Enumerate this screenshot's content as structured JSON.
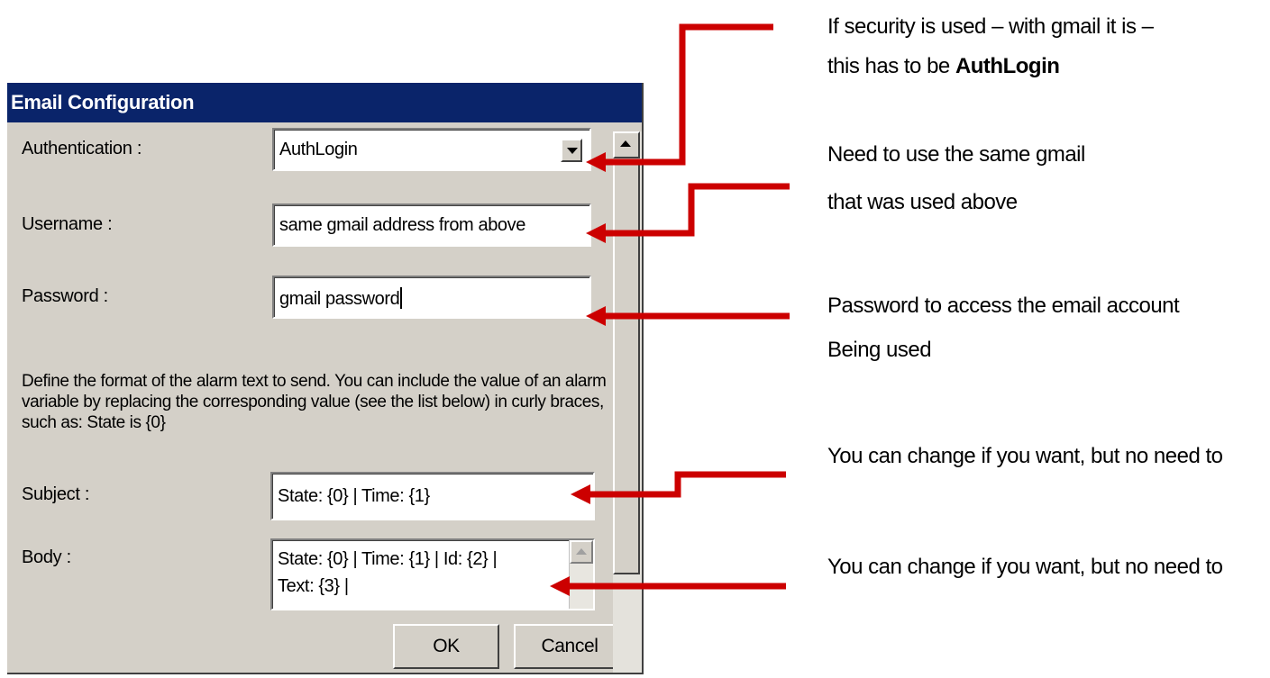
{
  "dialog": {
    "title": "Email Configuration",
    "fields": {
      "authentication": {
        "label": "Authentication  :",
        "value": "AuthLogin"
      },
      "username": {
        "label": "Username :",
        "value": "same gmail address from above"
      },
      "password": {
        "label": "Password :",
        "value": "gmail password"
      }
    },
    "description": "Define the format of the alarm text to send. You can include the value of an alarm variable by replacing the corresponding value (see the list below) in curly braces, such as: State is {0}",
    "subject": {
      "label": "Subject :",
      "value": "State: {0} | Time: {1}"
    },
    "body": {
      "label": "Body :",
      "line1": "State: {0} | Time: {1} | Id: {2} |",
      "line2": "Text: {3} |"
    },
    "buttons": {
      "ok": "OK",
      "cancel": "Cancel"
    }
  },
  "annotations": {
    "auth_line1": "If security is used – with gmail it is –",
    "auth_line2_prefix": "this has to be ",
    "auth_line2_bold": "AuthLogin",
    "username_line1": "Need to use the same gmail",
    "username_line2": "that was used above",
    "password_line1": "Password to access the email account",
    "password_line2": "Being used",
    "subject_note": "You can change if you want, but no need to",
    "body_note": "You can change if you want, but no need to"
  },
  "colors": {
    "titlebar": "#0a246a",
    "dialog_bg": "#d4d0c8",
    "arrow": "#cc0000"
  }
}
